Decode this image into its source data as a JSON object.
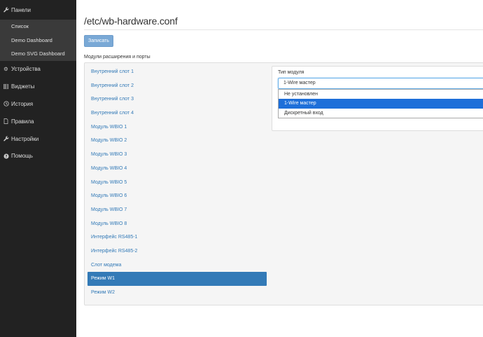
{
  "sidebar": {
    "panels_label": "Панели",
    "panels_icon": "wrench-icon",
    "subitems": [
      "Список",
      "Demo Dashboard",
      "Demo SVG Dashboard"
    ],
    "items": [
      {
        "label": "Устройства",
        "icon": "gear-icon"
      },
      {
        "label": "Виджеты",
        "icon": "grid-icon"
      },
      {
        "label": "История",
        "icon": "clock-icon"
      },
      {
        "label": "Правила",
        "icon": "document-icon"
      },
      {
        "label": "Настройки",
        "icon": "wrench-icon"
      },
      {
        "label": "Помощь",
        "icon": "question-icon"
      }
    ]
  },
  "main": {
    "title": "/etc/wb-hardware.conf",
    "save_label": "Записать",
    "section_label": "Модули расширения и порты"
  },
  "modules": {
    "items": [
      "Внутренний слот 1",
      "Внутренний слот 2",
      "Внутренний слот 3",
      "Внутренний слот 4",
      "Модуль WBIO 1",
      "Модуль WBIO 2",
      "Модуль WBIO 3",
      "Модуль WBIO 4",
      "Модуль WBIO 5",
      "Модуль WBIO 6",
      "Модуль WBIO 7",
      "Модуль WBIO 8",
      "Интерфейс RS485-1",
      "Интерфейс RS485-2",
      "Слот модема",
      "Режим W1",
      "Режим W2"
    ],
    "active_index": 15
  },
  "module_type": {
    "label": "Тип модуля",
    "selected_value": "1-Wire мастер",
    "options": [
      "Не установлен",
      "1-Wire мастер",
      "Дискретный вход"
    ],
    "highlighted_index": 1
  },
  "colors": {
    "sidebar_bg": "#222222",
    "subnav_bg": "#3a3a3a",
    "accent": "#337ab7",
    "highlight": "#1e6fd9"
  }
}
